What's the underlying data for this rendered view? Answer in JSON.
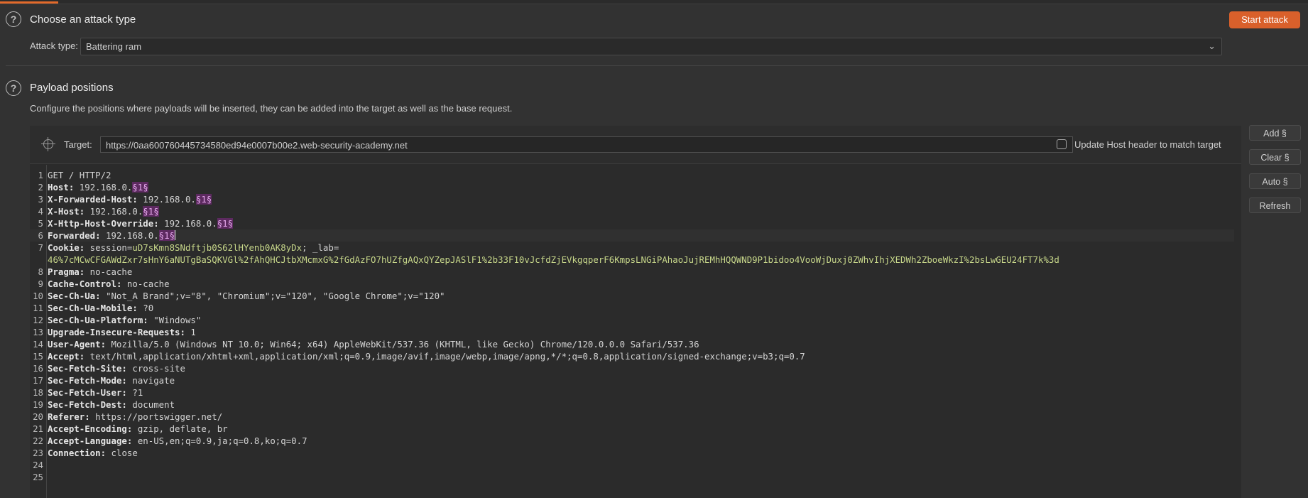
{
  "attack": {
    "title": "Choose an attack type",
    "start_label": "Start attack",
    "type_label": "Attack type:",
    "type_value": "Battering ram"
  },
  "payload": {
    "title": "Payload positions",
    "description": "Configure the positions where payloads will be inserted, they can be added into the target as well as the base request."
  },
  "target": {
    "label": "Target:",
    "url": "https://0aa600760445734580ed94e0007b00e2.web-security-academy.net",
    "update_host_label": "Update Host header to match target",
    "update_host_checked": false
  },
  "side_buttons": {
    "add": "Add §",
    "clear": "Clear §",
    "auto": "Auto §",
    "refresh": "Refresh"
  },
  "icons": [
    "help-icon",
    "chevron-down-icon",
    "crosshair-icon",
    "checkbox-icon"
  ],
  "colors": {
    "accent": "#d9602b",
    "marker_bg": "#5d2a60",
    "marker_fg": "#e5a8ec",
    "cookie_value": "#c7d78a"
  },
  "request": {
    "lines": [
      {
        "n": "1",
        "segs": [
          [
            "GET / HTTP/2",
            ""
          ]
        ]
      },
      {
        "n": "2",
        "segs": [
          [
            "Host:",
            "k"
          ],
          [
            " 192.168.0.",
            ""
          ],
          [
            "§1§",
            "m"
          ]
        ]
      },
      {
        "n": "3",
        "segs": [
          [
            "X-Forwarded-Host:",
            "k"
          ],
          [
            " 192.168.0.",
            ""
          ],
          [
            "§1§",
            "m"
          ]
        ]
      },
      {
        "n": "4",
        "segs": [
          [
            "X-Host:",
            "k"
          ],
          [
            " 192.168.0.",
            ""
          ],
          [
            "§1§",
            "m"
          ]
        ]
      },
      {
        "n": "5",
        "segs": [
          [
            "X-Http-Host-Override:",
            "k"
          ],
          [
            " 192.168.0.",
            ""
          ],
          [
            "§1§",
            "m"
          ]
        ]
      },
      {
        "n": "6",
        "segs": [
          [
            "Forwarded:",
            "k"
          ],
          [
            " 192.168.0.",
            ""
          ],
          [
            "§1§",
            "m"
          ]
        ],
        "caret": true
      },
      {
        "n": "7",
        "segs": [
          [
            "Cookie:",
            "k"
          ],
          [
            " session=",
            ""
          ],
          [
            "uD7sKmn8SNdftjb0S62lHYenb0AK8yDx",
            "g"
          ],
          [
            "; _lab=",
            ""
          ]
        ]
      },
      {
        "n": "",
        "segs": [
          [
            "46%7cMCwCFGAWdZxr7sHnY6aNUTgBaSQKVGl%2fAhQHCJtbXMcmxG%2fGdAzFO7hUZfgAQxQYZepJASlF1%2b33F10vJcfdZjEVkgqperF6KmpsLNGiPAhaoJujREMhHQQWND9P1bidoo4VooWjDuxj0ZWhvIhjXEDWh2ZboeWkzI%2bsLwGEU24FT7k%3d",
            "g"
          ]
        ]
      },
      {
        "n": "8",
        "segs": [
          [
            "Pragma:",
            "k"
          ],
          [
            " no-cache",
            ""
          ]
        ]
      },
      {
        "n": "9",
        "segs": [
          [
            "Cache-Control:",
            "k"
          ],
          [
            " no-cache",
            ""
          ]
        ]
      },
      {
        "n": "10",
        "segs": [
          [
            "Sec-Ch-Ua:",
            "k"
          ],
          [
            " \"Not_A Brand\";v=\"8\", \"Chromium\";v=\"120\", \"Google Chrome\";v=\"120\"",
            ""
          ]
        ]
      },
      {
        "n": "11",
        "segs": [
          [
            "Sec-Ch-Ua-Mobile:",
            "k"
          ],
          [
            " ?0",
            ""
          ]
        ]
      },
      {
        "n": "12",
        "segs": [
          [
            "Sec-Ch-Ua-Platform:",
            "k"
          ],
          [
            " \"Windows\"",
            ""
          ]
        ]
      },
      {
        "n": "13",
        "segs": [
          [
            "Upgrade-Insecure-Requests:",
            "k"
          ],
          [
            " 1",
            ""
          ]
        ]
      },
      {
        "n": "14",
        "segs": [
          [
            "User-Agent:",
            "k"
          ],
          [
            " Mozilla/5.0 (Windows NT 10.0; Win64; x64) AppleWebKit/537.36 (KHTML, like Gecko) Chrome/120.0.0.0 Safari/537.36",
            ""
          ]
        ]
      },
      {
        "n": "15",
        "segs": [
          [
            "Accept:",
            "k"
          ],
          [
            " text/html,application/xhtml+xml,application/xml;q=0.9,image/avif,image/webp,image/apng,*/*;q=0.8,application/signed-exchange;v=b3;q=0.7",
            ""
          ]
        ]
      },
      {
        "n": "16",
        "segs": [
          [
            "Sec-Fetch-Site:",
            "k"
          ],
          [
            " cross-site",
            ""
          ]
        ]
      },
      {
        "n": "17",
        "segs": [
          [
            "Sec-Fetch-Mode:",
            "k"
          ],
          [
            " navigate",
            ""
          ]
        ]
      },
      {
        "n": "18",
        "segs": [
          [
            "Sec-Fetch-User:",
            "k"
          ],
          [
            " ?1",
            ""
          ]
        ]
      },
      {
        "n": "19",
        "segs": [
          [
            "Sec-Fetch-Dest:",
            "k"
          ],
          [
            " document",
            ""
          ]
        ]
      },
      {
        "n": "20",
        "segs": [
          [
            "Referer:",
            "k"
          ],
          [
            " https://portswigger.net/",
            ""
          ]
        ]
      },
      {
        "n": "21",
        "segs": [
          [
            "Accept-Encoding:",
            "k"
          ],
          [
            " gzip, deflate, br",
            ""
          ]
        ]
      },
      {
        "n": "22",
        "segs": [
          [
            "Accept-Language:",
            "k"
          ],
          [
            " en-US,en;q=0.9,ja;q=0.8,ko;q=0.7",
            ""
          ]
        ]
      },
      {
        "n": "23",
        "segs": [
          [
            "Connection:",
            "k"
          ],
          [
            " close",
            ""
          ]
        ]
      },
      {
        "n": "24",
        "segs": []
      },
      {
        "n": "25",
        "segs": []
      }
    ]
  }
}
